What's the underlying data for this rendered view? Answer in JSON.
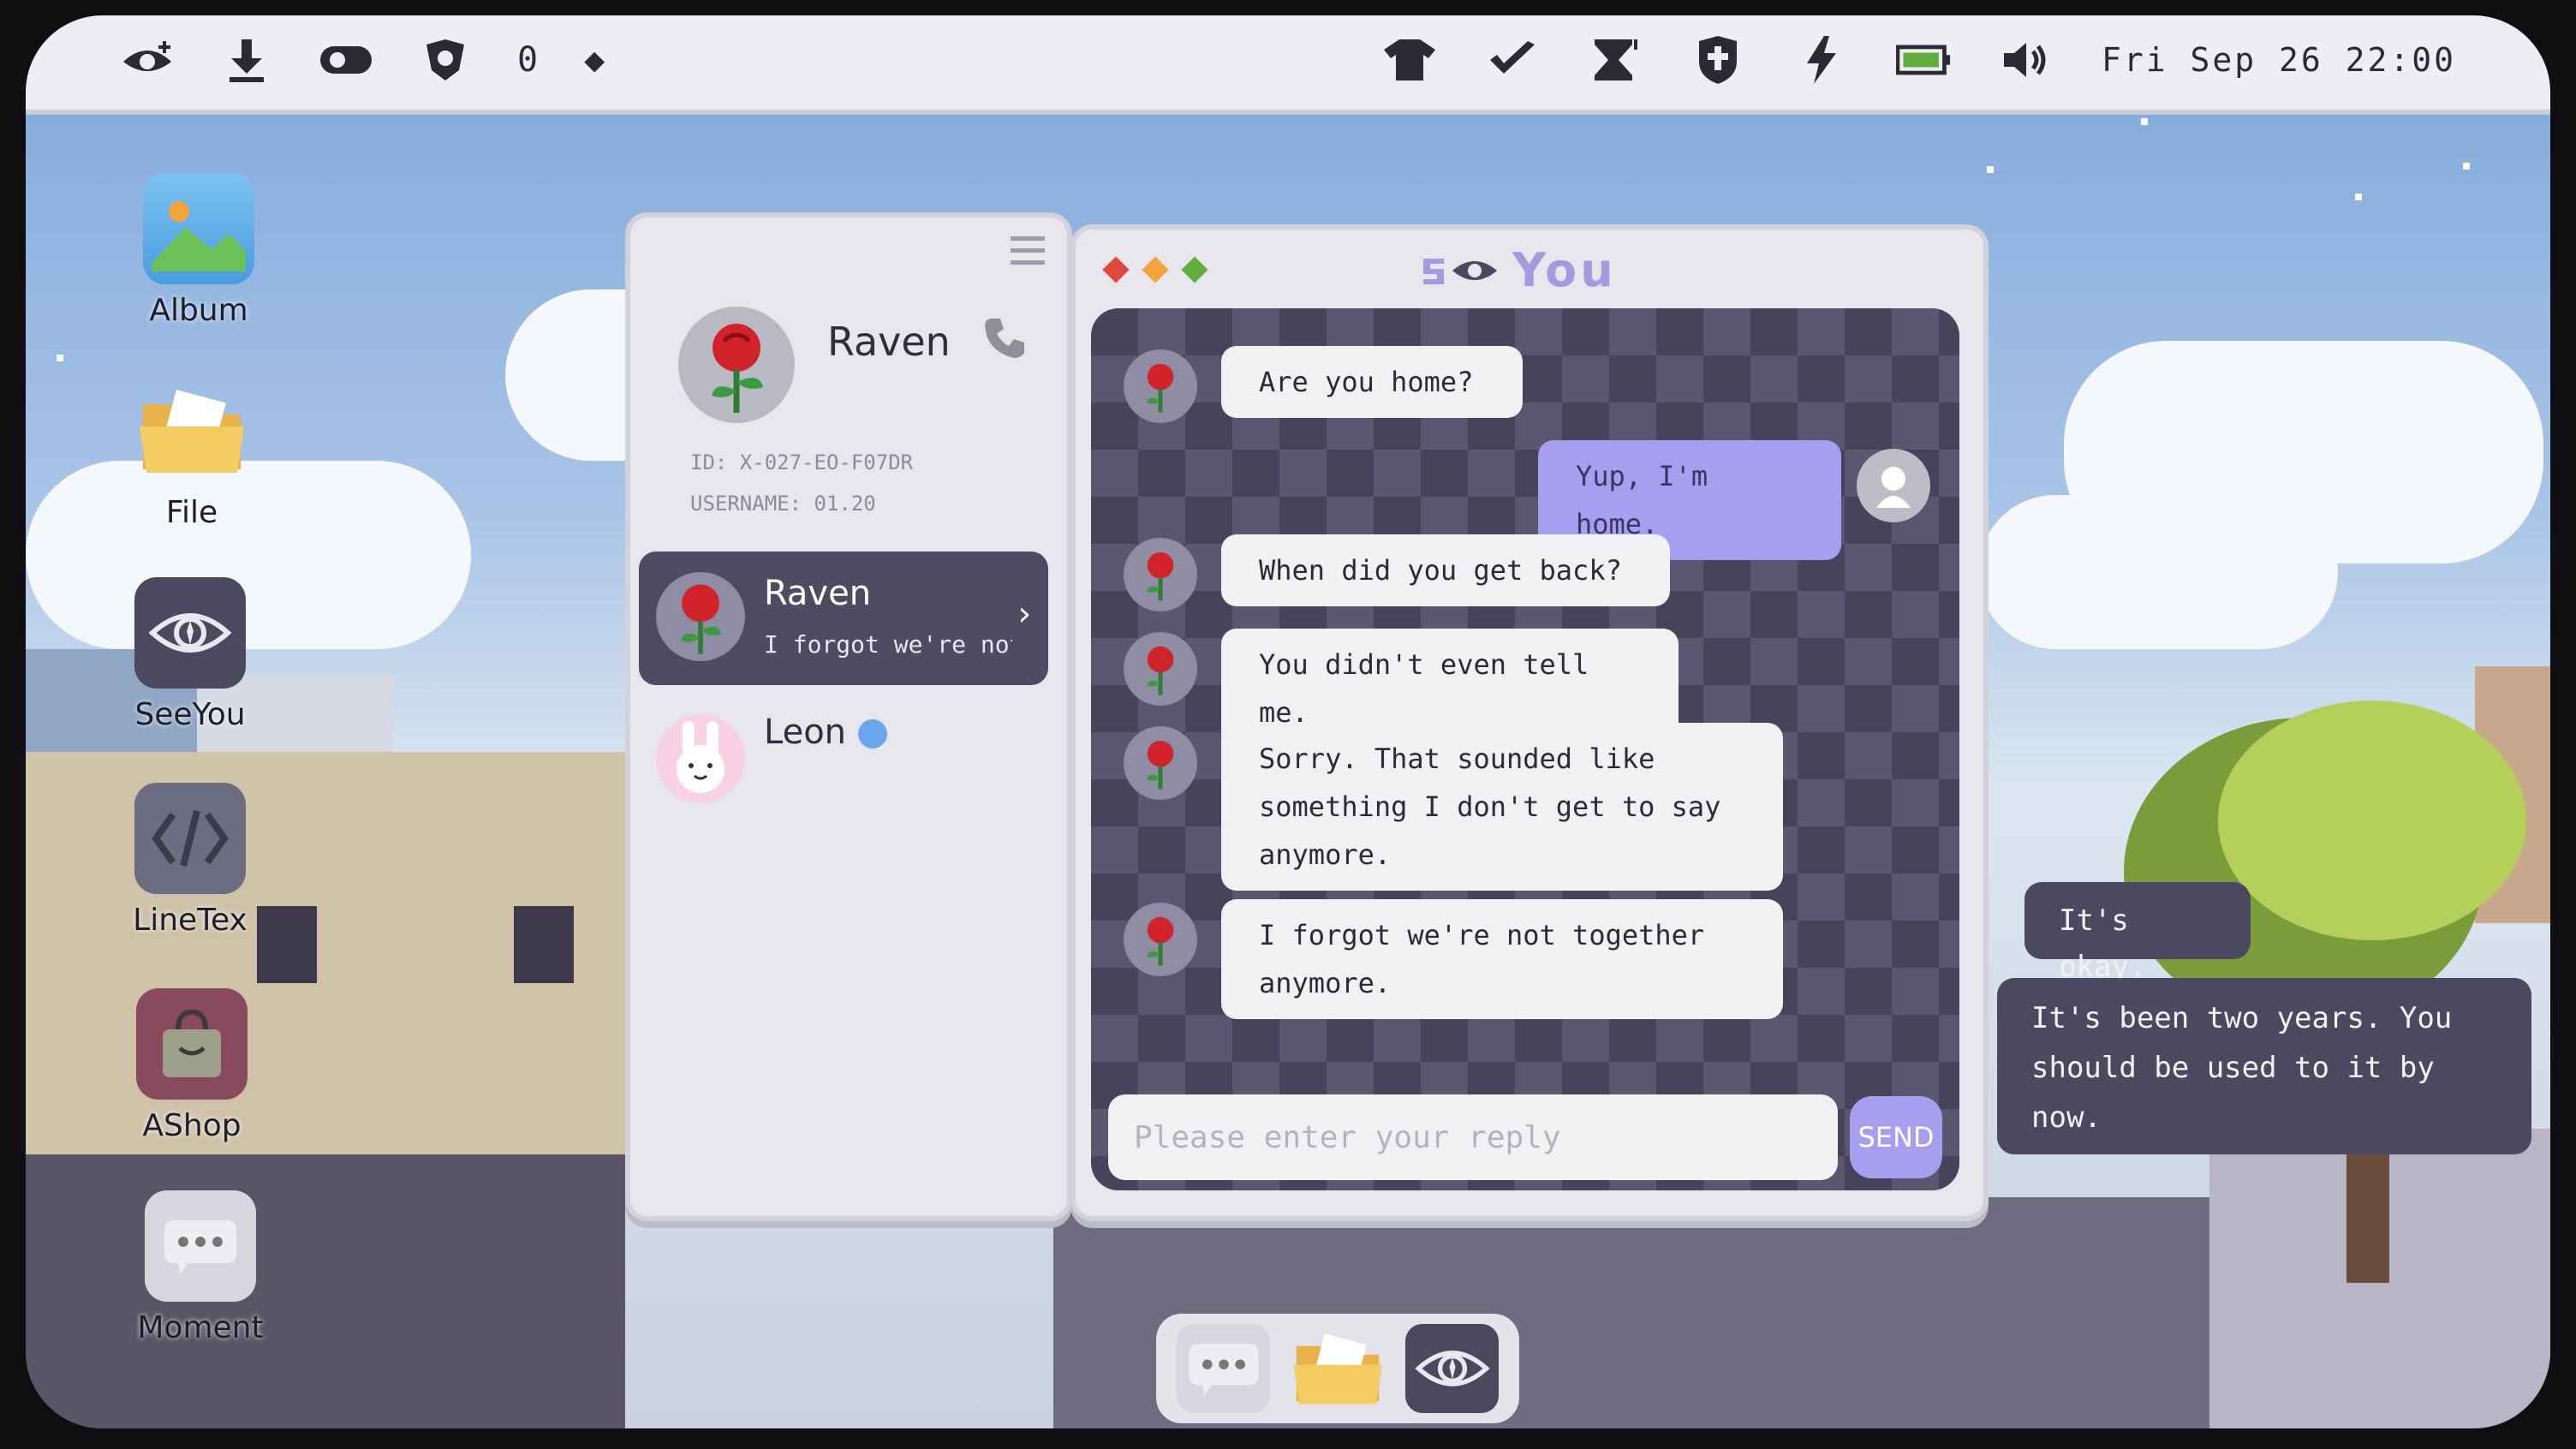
{
  "topbar": {
    "left_icons": [
      "eye-plus-icon",
      "download-icon",
      "toggle-icon",
      "badge-icon"
    ],
    "counter": "0",
    "right_icons": [
      "shirt-icon",
      "check-icon",
      "hourglass-icon",
      "shield-icon",
      "lightning-icon",
      "battery-icon",
      "volume-icon"
    ],
    "clock": "Fri Sep 26 22:00"
  },
  "desktop": {
    "icons": [
      {
        "label": "Album",
        "icon": "album-icon"
      },
      {
        "label": "File",
        "icon": "folder-icon"
      },
      {
        "label": "SeeYou",
        "icon": "seeyou-eye-icon"
      },
      {
        "label": "LineTex",
        "icon": "code-icon"
      },
      {
        "label": "AShop",
        "icon": "shop-bag-icon"
      },
      {
        "label": "Moment",
        "icon": "moment-chat-icon"
      }
    ]
  },
  "contacts": {
    "profile": {
      "name": "Raven",
      "id": "ID: X-027-EO-F07DR",
      "username": "USERNAME: 01.20"
    },
    "list": [
      {
        "name": "Raven",
        "preview": "I forgot we're not"
      },
      {
        "name": "Leon",
        "preview": ""
      }
    ]
  },
  "chat": {
    "title": "You",
    "messages": [
      {
        "from": "them",
        "text": "Are you home?"
      },
      {
        "from": "me",
        "text": "Yup, I'm home."
      },
      {
        "from": "them",
        "text": "When did you get back?"
      },
      {
        "from": "them",
        "text": "You didn't even tell me."
      },
      {
        "from": "them",
        "text": "Sorry. That sounded like something I don't get to say anymore."
      },
      {
        "from": "them",
        "text": "I forgot we're not together anymore."
      }
    ],
    "reply_placeholder": "Please enter your reply",
    "send_label": "SEND"
  },
  "dialogue": {
    "lines": [
      "It's okay.",
      "It's been two years. You should be used to it by now."
    ]
  },
  "dock": {
    "items": [
      "moment-chat-icon",
      "folder-icon",
      "seeyou-eye-icon"
    ]
  },
  "colors": {
    "accent": "#a89ef0",
    "dark_panel": "#4e4c63",
    "chat_bg": "#46445a",
    "window_bg": "#e6e6ec"
  }
}
